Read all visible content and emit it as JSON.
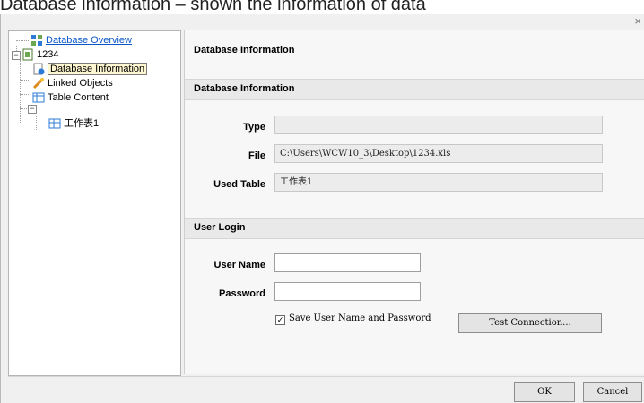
{
  "caption": "Database information – shown the information of data",
  "dialog": {
    "close_glyph": "×"
  },
  "tree": {
    "items": [
      {
        "label": "Database Overview",
        "icon": "database-overview-icon"
      },
      {
        "label": "1234",
        "icon": "database-file-icon"
      },
      {
        "label": "Database Information",
        "icon": "database-info-icon",
        "selected": true
      },
      {
        "label": "Linked Objects",
        "icon": "linked-objects-icon"
      },
      {
        "label": "Table Content",
        "icon": "table-icon"
      },
      {
        "label": "工作表1",
        "icon": "sheet-icon"
      }
    ]
  },
  "panel": {
    "title": "Database Information",
    "db_section": "Database Information",
    "type_label": "Type",
    "type_value": "",
    "file_label": "File",
    "file_value": "C:\\Users\\WCW10_3\\Desktop\\1234.xls",
    "used_table_label": "Used Table",
    "used_table_value": "工作表1",
    "login_section": "User Login",
    "username_label": "User Name",
    "username_value": "",
    "password_label": "Password",
    "password_value": "",
    "save_credentials_label": "Save User Name and Password",
    "save_credentials_checked": true,
    "test_connection_label": "Test Connection..."
  },
  "footer": {
    "ok_label": "OK",
    "cancel_label": "Cancel"
  }
}
